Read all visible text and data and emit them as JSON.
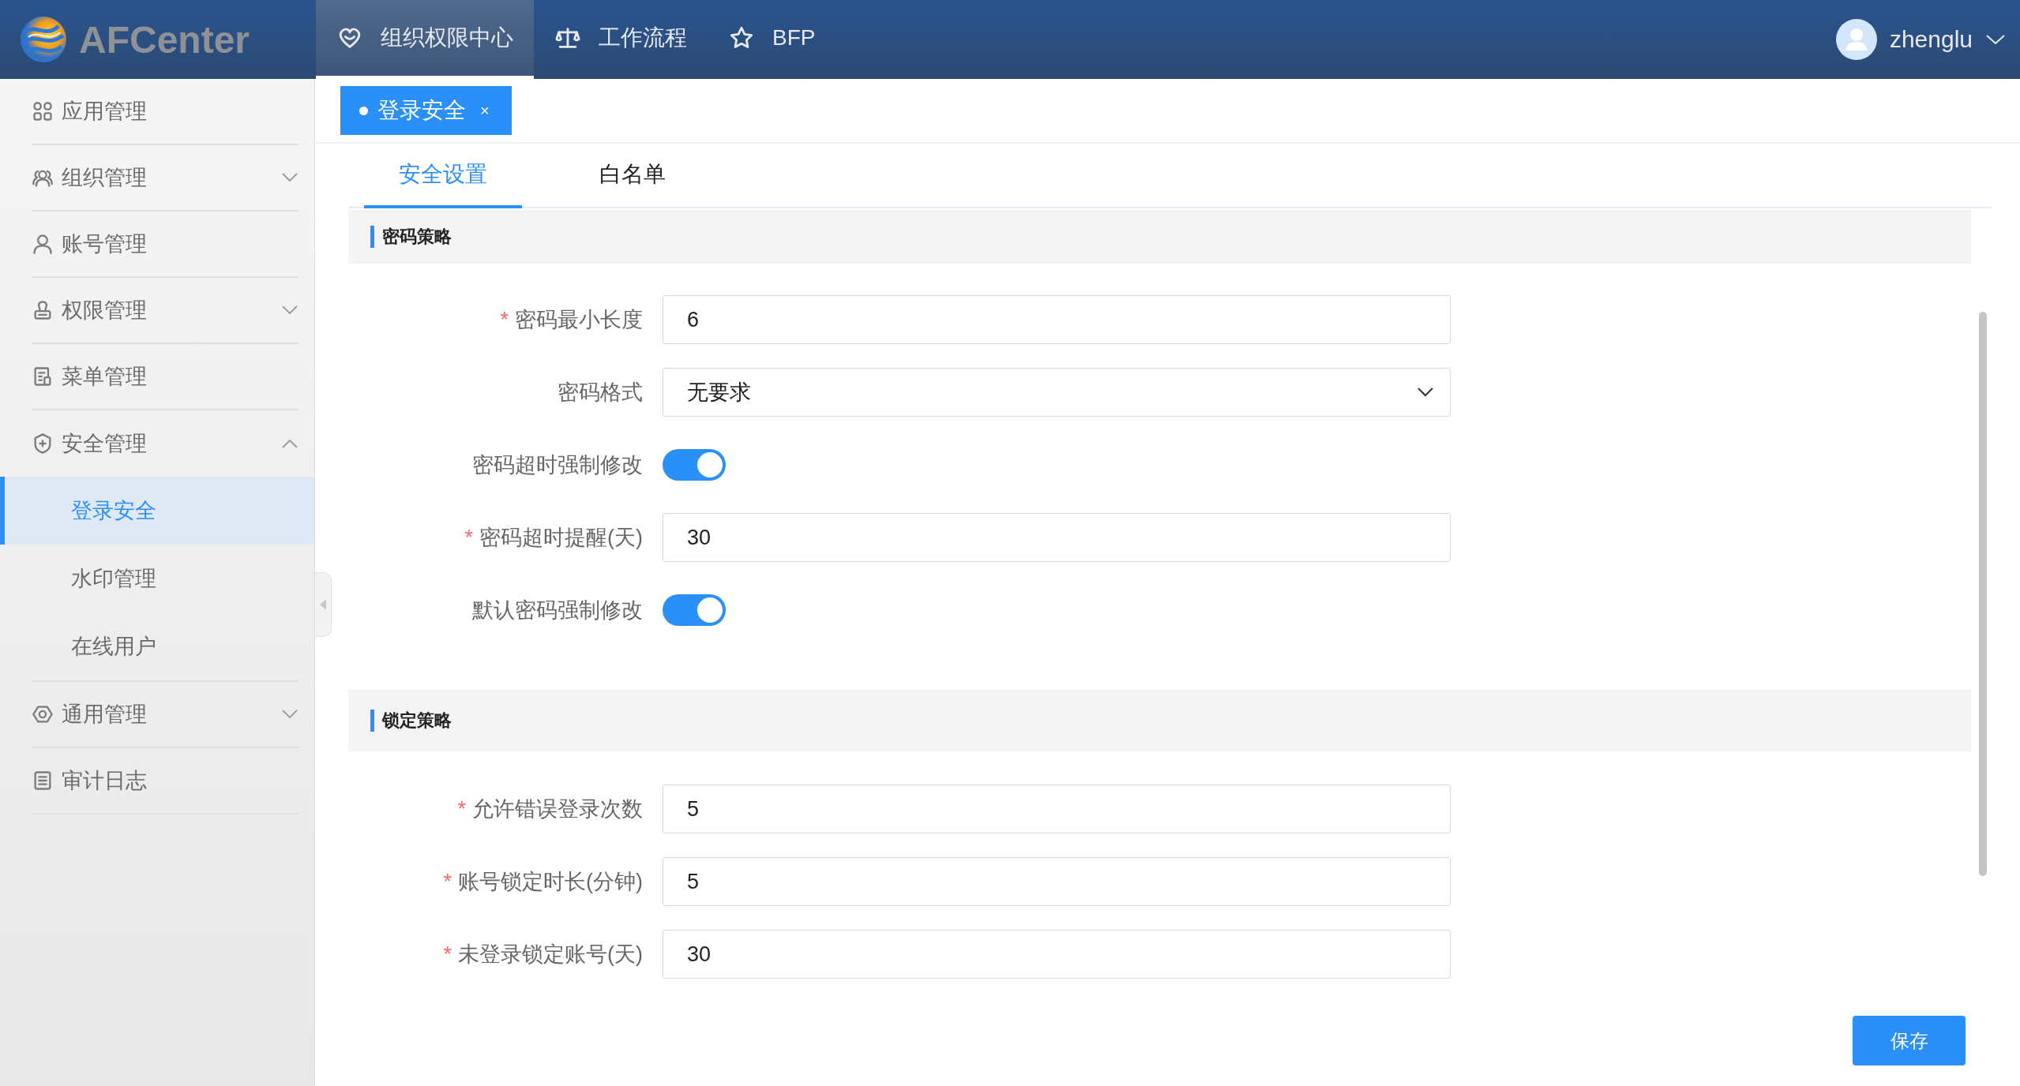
{
  "header": {
    "logo_text": "AFCenter",
    "nav": [
      {
        "label": "组织权限中心",
        "selected": true
      },
      {
        "label": "工作流程",
        "selected": false
      },
      {
        "label": "BFP",
        "selected": false
      }
    ],
    "user": {
      "name": "zhenglu"
    }
  },
  "sidebar": {
    "items": [
      {
        "label": "应用管理"
      },
      {
        "label": "组织管理",
        "expanded": false
      },
      {
        "label": "账号管理"
      },
      {
        "label": "权限管理",
        "expanded": false
      },
      {
        "label": "菜单管理"
      },
      {
        "label": "安全管理",
        "expanded": true,
        "children": [
          {
            "label": "登录安全",
            "selected": true
          },
          {
            "label": "水印管理",
            "selected": false
          },
          {
            "label": "在线用户",
            "selected": false
          }
        ]
      },
      {
        "label": "通用管理",
        "expanded": false
      },
      {
        "label": "审计日志"
      }
    ]
  },
  "page_tags": [
    {
      "label": "登录安全",
      "selected": true,
      "close": "×"
    }
  ],
  "tabs": [
    {
      "label": "安全设置",
      "selected": true
    },
    {
      "label": "白名单",
      "selected": false
    }
  ],
  "sections": [
    {
      "title": "密码策略",
      "fields": [
        {
          "kind": "input",
          "required_mark": "*",
          "label": "密码最小长度",
          "value": "6"
        },
        {
          "kind": "select",
          "label": "密码格式",
          "value": "无要求"
        },
        {
          "kind": "switch",
          "label": "密码超时强制修改",
          "on": true
        },
        {
          "kind": "input",
          "required_mark": "*",
          "label": "密码超时提醒(天)",
          "value": "30"
        },
        {
          "kind": "switch",
          "label": "默认密码强制修改",
          "on": true
        }
      ]
    },
    {
      "title": "锁定策略",
      "fields": [
        {
          "kind": "input",
          "required_mark": "*",
          "label": "允许错误登录次数",
          "value": "5"
        },
        {
          "kind": "input",
          "required_mark": "*",
          "label": "账号锁定时长(分钟)",
          "value": "5"
        },
        {
          "kind": "input",
          "required_mark": "*",
          "label": "未登录锁定账号(天)",
          "value": "30"
        }
      ]
    }
  ],
  "save_button": "保存"
}
